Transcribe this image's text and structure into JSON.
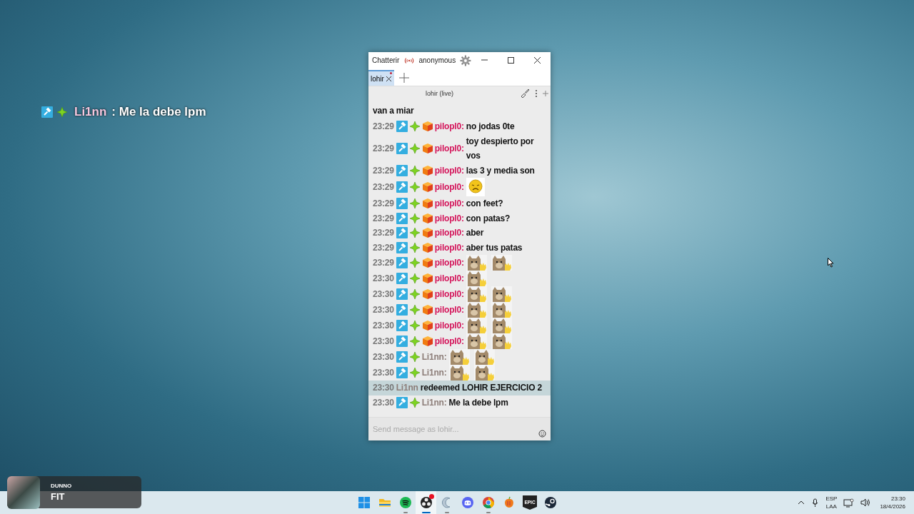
{
  "overlay_message": {
    "badges": [
      {
        "kind": "moderator"
      },
      {
        "kind": "diamond"
      }
    ],
    "user": "Li1nn",
    "text": ": Me la debe lpm"
  },
  "chat_window": {
    "app_title": "Chatterir",
    "account": "anonymous",
    "tabs": [
      {
        "label": "lohir",
        "selected": true,
        "unread": true
      }
    ],
    "channel_header": "lohir (live)",
    "messages": [
      {
        "kind": "continuation",
        "text": "van a miar"
      },
      {
        "kind": "chat",
        "time": "23:29",
        "badges": [
          {
            "kind": "moderator"
          },
          {
            "kind": "diamond"
          },
          {
            "kind": "cube"
          }
        ],
        "user": "pilopl0:",
        "color": "#d4145a",
        "text": "no jodas 0te"
      },
      {
        "kind": "chat",
        "time": "23:29",
        "badges": [
          {
            "kind": "moderator"
          },
          {
            "kind": "diamond"
          },
          {
            "kind": "cube"
          }
        ],
        "user": "pilopl0:",
        "color": "#d4145a",
        "text": "toy despierto por vos"
      },
      {
        "kind": "chat",
        "time": "23:29",
        "badges": [
          {
            "kind": "moderator"
          },
          {
            "kind": "diamond"
          },
          {
            "kind": "cube"
          }
        ],
        "user": "pilopl0:",
        "color": "#d4145a",
        "text": "las 3 y media son"
      },
      {
        "kind": "chat",
        "time": "23:29",
        "badges": [
          {
            "kind": "moderator"
          },
          {
            "kind": "diamond"
          },
          {
            "kind": "cube"
          }
        ],
        "user": "pilopl0:",
        "color": "#d4145a",
        "emotes": [
          {
            "kind": "face"
          }
        ]
      },
      {
        "kind": "chat",
        "time": "23:29",
        "badges": [
          {
            "kind": "moderator"
          },
          {
            "kind": "diamond"
          },
          {
            "kind": "cube"
          }
        ],
        "user": "pilopl0:",
        "color": "#d4145a",
        "text": "con feet?"
      },
      {
        "kind": "chat",
        "time": "23:29",
        "badges": [
          {
            "kind": "moderator"
          },
          {
            "kind": "diamond"
          },
          {
            "kind": "cube"
          }
        ],
        "user": "pilopl0:",
        "color": "#d4145a",
        "text": "con patas?"
      },
      {
        "kind": "chat",
        "time": "23:29",
        "badges": [
          {
            "kind": "moderator"
          },
          {
            "kind": "diamond"
          },
          {
            "kind": "cube"
          }
        ],
        "user": "pilopl0:",
        "color": "#d4145a",
        "text": "aber"
      },
      {
        "kind": "chat",
        "time": "23:29",
        "badges": [
          {
            "kind": "moderator"
          },
          {
            "kind": "diamond"
          },
          {
            "kind": "cube"
          }
        ],
        "user": "pilopl0:",
        "color": "#d4145a",
        "text": "aber tus patas"
      },
      {
        "kind": "chat",
        "time": "23:29",
        "badges": [
          {
            "kind": "moderator"
          },
          {
            "kind": "diamond"
          },
          {
            "kind": "cube"
          }
        ],
        "user": "pilopl0:",
        "color": "#d4145a",
        "emotes": [
          {
            "kind": "cat"
          },
          {
            "kind": "cat"
          }
        ]
      },
      {
        "kind": "chat",
        "time": "23:30",
        "badges": [
          {
            "kind": "moderator"
          },
          {
            "kind": "diamond"
          },
          {
            "kind": "cube"
          }
        ],
        "user": "pilopl0:",
        "color": "#d4145a",
        "emotes": [
          {
            "kind": "cat"
          }
        ]
      },
      {
        "kind": "chat",
        "time": "23:30",
        "badges": [
          {
            "kind": "moderator"
          },
          {
            "kind": "diamond"
          },
          {
            "kind": "cube"
          }
        ],
        "user": "pilopl0:",
        "color": "#d4145a",
        "emotes": [
          {
            "kind": "cat"
          },
          {
            "kind": "cat"
          }
        ]
      },
      {
        "kind": "chat",
        "time": "23:30",
        "badges": [
          {
            "kind": "moderator"
          },
          {
            "kind": "diamond"
          },
          {
            "kind": "cube"
          }
        ],
        "user": "pilopl0:",
        "color": "#d4145a",
        "emotes": [
          {
            "kind": "cat"
          },
          {
            "kind": "cat"
          }
        ]
      },
      {
        "kind": "chat",
        "time": "23:30",
        "badges": [
          {
            "kind": "moderator"
          },
          {
            "kind": "diamond"
          },
          {
            "kind": "cube"
          }
        ],
        "user": "pilopl0:",
        "color": "#d4145a",
        "emotes": [
          {
            "kind": "cat"
          },
          {
            "kind": "cat"
          }
        ]
      },
      {
        "kind": "chat",
        "time": "23:30",
        "badges": [
          {
            "kind": "moderator"
          },
          {
            "kind": "diamond"
          },
          {
            "kind": "cube"
          }
        ],
        "user": "pilopl0:",
        "color": "#d4145a",
        "emotes": [
          {
            "kind": "cat"
          },
          {
            "kind": "cat"
          }
        ]
      },
      {
        "kind": "chat",
        "time": "23:30",
        "badges": [
          {
            "kind": "moderator"
          },
          {
            "kind": "diamond"
          }
        ],
        "user": "Li1nn:",
        "color": "#8c7d78",
        "emotes": [
          {
            "kind": "cat"
          },
          {
            "kind": "cat"
          }
        ]
      },
      {
        "kind": "chat",
        "time": "23:30",
        "badges": [
          {
            "kind": "moderator"
          },
          {
            "kind": "diamond"
          }
        ],
        "user": "Li1nn:",
        "color": "#8c7d78",
        "emotes": [
          {
            "kind": "cat"
          },
          {
            "kind": "cat"
          }
        ]
      },
      {
        "kind": "redemption",
        "time": "23:30",
        "user": "Li1nn",
        "color": "#8c7d78",
        "text": "redeemed LOHIR EJERCICIO 2"
      },
      {
        "kind": "chat",
        "time": "23:30",
        "badges": [
          {
            "kind": "moderator"
          },
          {
            "kind": "diamond"
          }
        ],
        "user": "Li1nn:",
        "color": "#8c7d78",
        "text": "Me la debe lpm"
      }
    ],
    "input": {
      "placeholder": "Send message as lohir..."
    }
  },
  "media_widget": {
    "artist": "DUNNO",
    "title": "FIT"
  },
  "taskbar": {
    "apps": [
      {
        "kind": "start",
        "running": false,
        "active": false
      },
      {
        "kind": "folder",
        "running": false,
        "active": false
      },
      {
        "kind": "music",
        "running": true,
        "active": false
      },
      {
        "kind": "recorder",
        "running": true,
        "active": true,
        "notification": true
      },
      {
        "kind": "crescent",
        "running": true,
        "active": false
      },
      {
        "kind": "chat",
        "running": false,
        "active": false
      },
      {
        "kind": "browser",
        "running": true,
        "active": false
      },
      {
        "kind": "fruit",
        "running": false,
        "active": false
      },
      {
        "kind": "store",
        "running": false,
        "active": false,
        "label": "EPIC"
      },
      {
        "kind": "steam",
        "running": false,
        "active": false
      }
    ],
    "language": [
      "ESP",
      "LAA"
    ],
    "time": "23:30",
    "date": "18/4/2026"
  }
}
